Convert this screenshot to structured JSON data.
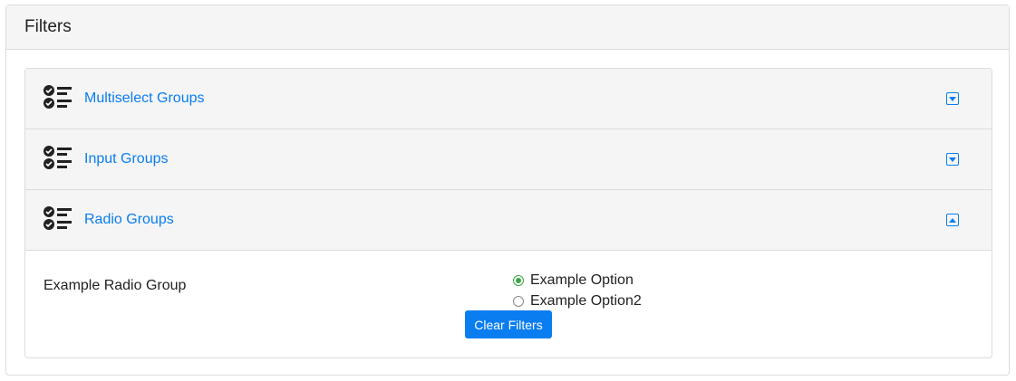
{
  "card": {
    "title": "Filters"
  },
  "accordion": [
    {
      "label": "Multiselect Groups",
      "expanded": false,
      "icon": "checklist-icon"
    },
    {
      "label": "Input Groups",
      "expanded": false,
      "icon": "checklist-icon"
    },
    {
      "label": "Radio Groups",
      "expanded": true,
      "icon": "checklist-icon"
    }
  ],
  "radio_group": {
    "label": "Example Radio Group",
    "options": [
      {
        "label": "Example Option",
        "selected": true
      },
      {
        "label": "Example Option2",
        "selected": false
      }
    ]
  },
  "clear_button": "Clear Filters",
  "colors": {
    "accent": "#0a7df0",
    "selected": "#3aa845"
  }
}
